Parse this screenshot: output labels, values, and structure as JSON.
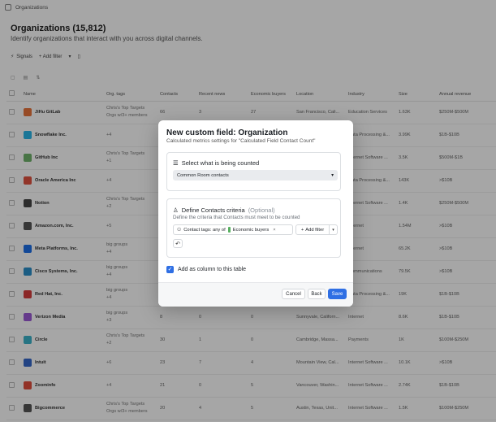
{
  "app": {
    "breadcrumb": "Organizations",
    "title": "Organizations (15,812)",
    "subtitle": "Identify organizations that interact with you across digital channels.",
    "signals_label": "Signals",
    "add_filter_label": "+ Add filter"
  },
  "table": {
    "headers": [
      "Name",
      "Org. tags",
      "Contacts",
      "Recent news",
      "Economic buyers",
      "Location",
      "Industry",
      "Size",
      "Annual revenue"
    ],
    "rows": [
      {
        "name": "JiHu GitLab",
        "tag": "Chris's Top Targets",
        "tag2": "Orgs w/3+ members",
        "contacts": "66",
        "recent": "3",
        "eco": "27",
        "location": "San Francisco, Cali...",
        "industry": "Education Services",
        "size": "1.63K",
        "revenue": "$250M-$500M",
        "color": "#e8743b"
      },
      {
        "name": "Snowflake Inc.",
        "tag": "+4",
        "tag2": "",
        "contacts": "",
        "recent": "",
        "eco": "",
        "location": "",
        "industry": "Data Processing &...",
        "size": "3.99K",
        "revenue": "$1B-$10B",
        "color": "#29b5e8"
      },
      {
        "name": "GitHub Inc",
        "tag": "Chris's Top Targets",
        "tag2": "+1",
        "contacts": "",
        "recent": "",
        "eco": "",
        "location": "",
        "industry": "Internet Software ...",
        "size": "3.5K",
        "revenue": "$500M-$1B",
        "color": "#6fb26a"
      },
      {
        "name": "Oracle America Inc",
        "tag": "+4",
        "tag2": "",
        "contacts": "",
        "recent": "",
        "eco": "",
        "location": "",
        "industry": "Data Processing &...",
        "size": "143K",
        "revenue": ">$10B",
        "color": "#e0523f"
      },
      {
        "name": "Notion",
        "tag": "Chris's Top Targets",
        "tag2": "+2",
        "contacts": "",
        "recent": "",
        "eco": "",
        "location": "",
        "industry": "Internet Software ...",
        "size": "1.4K",
        "revenue": "$250M-$500M",
        "color": "#444444"
      },
      {
        "name": "Amazon.com, Inc.",
        "tag": "+5",
        "tag2": "",
        "contacts": "",
        "recent": "",
        "eco": "",
        "location": "",
        "industry": "Internet",
        "size": "1.54M",
        "revenue": ">$10B",
        "color": "#555555"
      },
      {
        "name": "Meta Platforms, Inc.",
        "tag": "big groups",
        "tag2": "+4",
        "contacts": "",
        "recent": "",
        "eco": "",
        "location": "",
        "industry": "Internet",
        "size": "65.2K",
        "revenue": ">$10B",
        "color": "#1c6fe8"
      },
      {
        "name": "Cisco Systems, Inc.",
        "tag": "big groups",
        "tag2": "+4",
        "contacts": "",
        "recent": "",
        "eco": "",
        "location": "",
        "industry": "Communications",
        "size": "79.5K",
        "revenue": ">$10B",
        "color": "#2a8fc9"
      },
      {
        "name": "Red Hat, Inc.",
        "tag": "big groups",
        "tag2": "+4",
        "contacts": "",
        "recent": "",
        "eco": "",
        "location": "",
        "industry": "Data Processing &...",
        "size": "19K",
        "revenue": "$1B-$10B",
        "color": "#d63c3c"
      },
      {
        "name": "Verizon Media",
        "tag": "big groups",
        "tag2": "+3",
        "contacts": "8",
        "recent": "0",
        "eco": "0",
        "location": "Sunnyvale, Californ...",
        "industry": "Internet",
        "size": "8.6K",
        "revenue": "$1B-$10B",
        "color": "#9b59d6"
      },
      {
        "name": "Circle",
        "tag": "Chris's Top Targets",
        "tag2": "+2",
        "contacts": "30",
        "recent": "1",
        "eco": "0",
        "location": "Cambridge, Massa...",
        "industry": "Payments",
        "size": "1K",
        "revenue": "$100M-$250M",
        "color": "#3bb2c9"
      },
      {
        "name": "Intuit",
        "tag": "+6",
        "tag2": "",
        "contacts": "23",
        "recent": "7",
        "eco": "4",
        "location": "Mountain View, Cal...",
        "industry": "Internet Software ...",
        "size": "10.1K",
        "revenue": ">$10B",
        "color": "#3568c9"
      },
      {
        "name": "Zoominfo",
        "tag": "+4",
        "tag2": "",
        "contacts": "21",
        "recent": "0",
        "eco": "5",
        "location": "Vancouver, Washin...",
        "industry": "Internet Software ...",
        "size": "2.74K",
        "revenue": "$1B-$10B",
        "color": "#e04e3c"
      },
      {
        "name": "Bigcommerce",
        "tag": "Chris's Top Targets",
        "tag2": "Orgs w/3+ members",
        "contacts": "20",
        "recent": "4",
        "eco": "5",
        "location": "Austin, Texas, Unit...",
        "industry": "Internet Software ...",
        "size": "1.5K",
        "revenue": "$100M-$250M",
        "color": "#555555"
      }
    ]
  },
  "modal": {
    "title": "New custom field: Organization",
    "subtitle": "Calculated metrics settings for \"Calculated Field Contact Count\"",
    "section1": {
      "heading": "Select what is being counted",
      "select_value": "Common Room contacts"
    },
    "section2": {
      "heading": "Define Contacts criteria",
      "optional": "(Optional)",
      "description": "Define the criteria that Contacts must meet to be counted",
      "filter_prefix": "Contact tags: any of",
      "filter_value": "Economic buyers",
      "add_filter": "Add filter"
    },
    "checkbox_label": "Add as column to this table",
    "checkbox_checked": true,
    "buttons": {
      "cancel": "Cancel",
      "back": "Back",
      "save": "Save"
    },
    "colors": {
      "primary": "#2f6fe4",
      "tag_green": "#57b060"
    }
  }
}
